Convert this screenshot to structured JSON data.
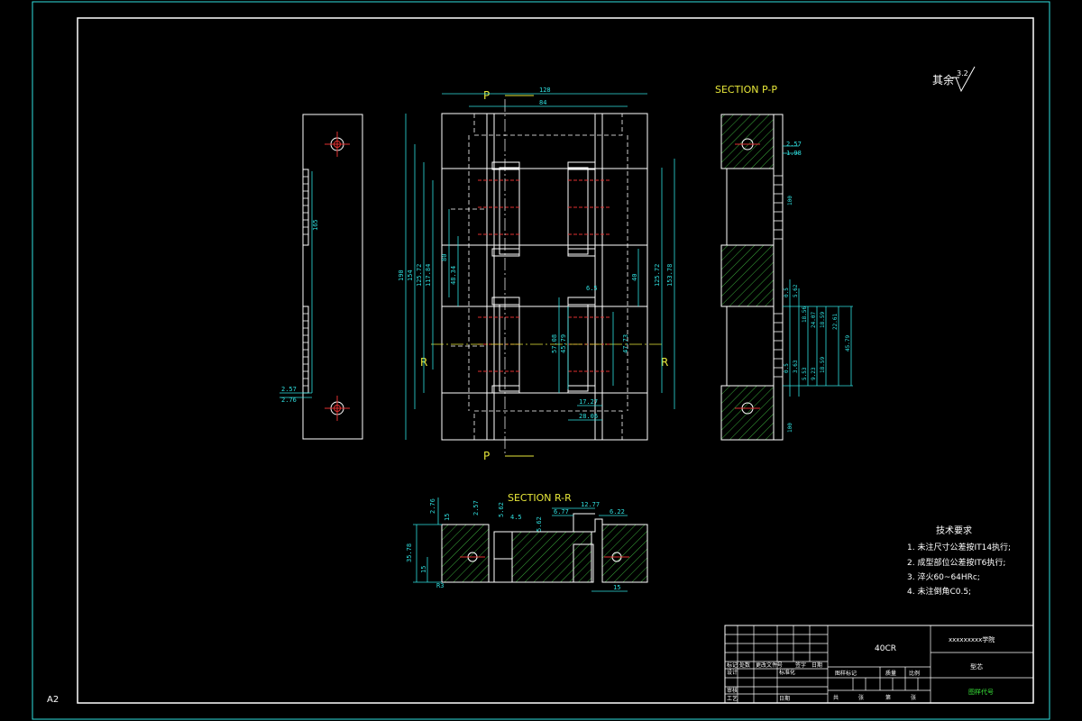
{
  "sheet": {
    "size_label": "A2",
    "roughness_note": "其余",
    "roughness_value": "3.2"
  },
  "sections": {
    "pp_title": "SECTION P-P",
    "rr_title": "SECTION R-R",
    "cut_p_top": "P",
    "cut_p_bottom": "P",
    "cut_r_left": "R",
    "cut_r_right": "R"
  },
  "dimensions": {
    "left_view": [
      "2.57",
      "2.76",
      "165"
    ],
    "plan_top": [
      "128",
      "84"
    ],
    "plan_left": [
      "190",
      "154",
      "125.72",
      "117.84",
      "80",
      "48.34"
    ],
    "plan_right": [
      "40",
      "125.72",
      "153.78"
    ],
    "plan_inner": [
      "6.5",
      "57.08",
      "45.79",
      "47.73",
      "17.27",
      "28.06"
    ],
    "pp": [
      "2.57",
      "1.98",
      "0.5",
      "5.62",
      "18.56",
      "24.07",
      "18.59",
      "22.61",
      "45.79",
      "0.5",
      "3.63",
      "5.53",
      "9.23",
      "18.59",
      "100",
      "100"
    ],
    "rr": [
      "2.76",
      "2.57",
      "5.62",
      "5.62",
      "12.77",
      "6.77",
      "6.22",
      "4.5",
      "35.78",
      "15",
      "15",
      "15",
      "R3"
    ]
  },
  "notes": {
    "title": "技术要求",
    "items": [
      "1. 未注尺寸公差按IT14执行;",
      "2. 成型部位公差按IT6执行;",
      "3. 淬火60~64HRc;",
      "4. 未注倒角C0.5;"
    ]
  },
  "title_block": {
    "material": "40CR",
    "school": "xxxxxxxxx学院",
    "part_name": "型芯",
    "drawing_no": "图样代号",
    "headers_row1": [
      "标记",
      "处数",
      "更改文件号",
      "签字",
      "日期"
    ],
    "headers_row2": [
      "设计",
      "标准化"
    ],
    "headers_row3": [
      "审核"
    ],
    "headers_row4": [
      "工艺",
      "日期"
    ],
    "scale_headers": [
      "图样标记",
      "质量",
      "比例"
    ],
    "sheet_headers": [
      "共",
      "张",
      "第",
      "张"
    ]
  },
  "colors": {
    "background": "#000000",
    "border": "#2fe0e0",
    "outline": "#ffffff",
    "dimension": "#2fe0e0",
    "hatch": "#3aa83a",
    "hidden": "#e03030",
    "label": "#e8e83a"
  }
}
